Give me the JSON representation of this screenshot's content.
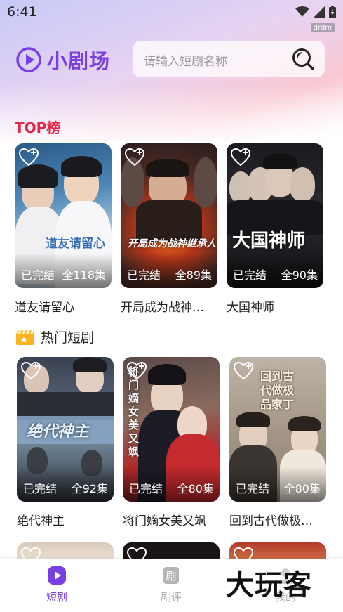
{
  "status_bar": {
    "time": "6:41",
    "tag": "drdm"
  },
  "header": {
    "app_name": "小剧场",
    "search_placeholder": "请输入短剧名称"
  },
  "top_section": {
    "title": "TOP榜",
    "items": [
      {
        "title": "道友请留心",
        "status": "已完结",
        "episodes": "全118集",
        "poster_text": "道友请留心"
      },
      {
        "title": "开局成为战神…",
        "status": "已完结",
        "episodes": "全89集",
        "poster_text": "开局成为战神继承人"
      },
      {
        "title": "大国神师",
        "status": "已完结",
        "episodes": "全90集",
        "poster_text": "大国神师"
      }
    ]
  },
  "hot_section": {
    "title": "热门短剧",
    "items": [
      {
        "title": "绝代神主",
        "status": "已完结",
        "episodes": "全92集",
        "poster_text": "绝代神主"
      },
      {
        "title": "将门嫡女美又飒",
        "status": "已完结",
        "episodes": "全80集",
        "poster_text": "将门嫡女美又飒"
      },
      {
        "title": "回到古代做极…",
        "status": "已完结",
        "episodes": "全80集",
        "poster_text": "回到古代做极品家丁"
      }
    ]
  },
  "tab_bar": {
    "tabs": [
      {
        "label": "短剧",
        "active": true
      },
      {
        "label": "剧评",
        "active": false
      },
      {
        "label": "我的",
        "active": false
      }
    ],
    "watermark": "大玩客"
  },
  "colors": {
    "brand": "#7a3fe0",
    "top_title": "#e8254a",
    "tab_active": "#7a3fe0",
    "tab_inactive": "#b0b0b0"
  }
}
